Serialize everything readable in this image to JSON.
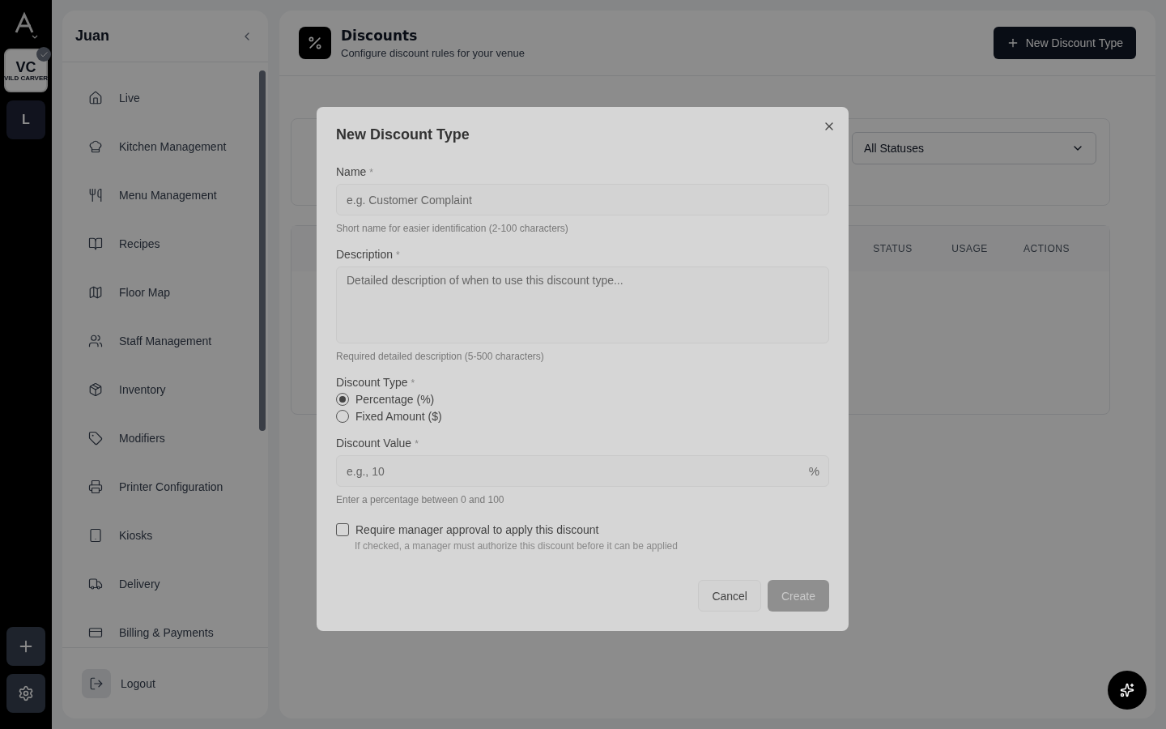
{
  "rail": {
    "logo_badge": "L",
    "venue_logo": {
      "mark": "VC",
      "name": "VILD CARVER",
      "checked": true
    }
  },
  "sidebar": {
    "title": "Juan",
    "items": [
      {
        "label": "Live"
      },
      {
        "label": "Kitchen Management"
      },
      {
        "label": "Menu Management"
      },
      {
        "label": "Recipes"
      },
      {
        "label": "Floor Map"
      },
      {
        "label": "Staff Management"
      },
      {
        "label": "Inventory"
      },
      {
        "label": "Modifiers"
      },
      {
        "label": "Printer Configuration"
      },
      {
        "label": "Kiosks"
      },
      {
        "label": "Delivery"
      },
      {
        "label": "Billing & Payments"
      }
    ],
    "logout": "Logout"
  },
  "header": {
    "title": "Discounts",
    "subtitle": "Configure discount rules for your venue",
    "button": "New Discount Type"
  },
  "filters": {
    "status": "All Statuses"
  },
  "table": {
    "columns": [
      "STATUS",
      "USAGE",
      "ACTIONS"
    ]
  },
  "dialog": {
    "title": "New Discount Type",
    "fields": [
      {
        "kind": "input",
        "label": "Name",
        "placeholder": "e.g. Customer Complaint",
        "hint": "Short name for easier identification (2-100 characters)"
      },
      {
        "kind": "textarea",
        "label": "Description",
        "placeholder": "Detailed description of when to use this discount type...",
        "hint": "Required detailed description (5-500 characters)"
      },
      {
        "kind": "radio",
        "label": "Discount Type",
        "options": [
          {
            "label": "Percentage (%)",
            "selected": true
          },
          {
            "label": "Fixed Amount ($)",
            "selected": false
          }
        ]
      },
      {
        "kind": "input",
        "label": "Discount Value",
        "placeholder": "e.g., 10",
        "suffix": "%",
        "hint": "Enter a percentage between 0 and 100"
      },
      {
        "kind": "checkbox",
        "label": "Require manager approval to apply this discount",
        "checked": false,
        "hint": "If checked, a manager must authorize this discount before it can be applied"
      }
    ],
    "required_mark": "*",
    "cancel": "Cancel",
    "submit": {
      "label": "Create",
      "disabled": true
    }
  }
}
